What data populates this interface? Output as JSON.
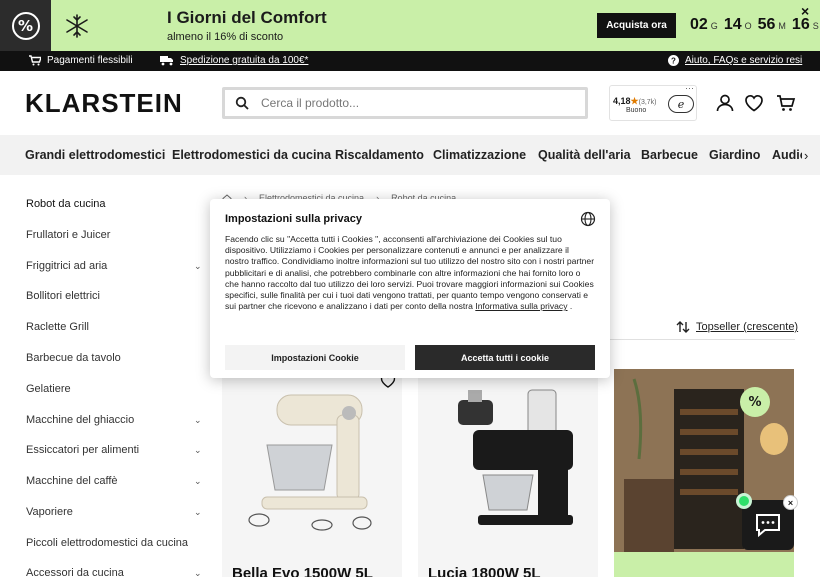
{
  "promo": {
    "title": "I Giorni del Comfort",
    "subtitle": "almeno il 16% di sconto",
    "button": "Acquista ora",
    "timer": [
      {
        "value": "02",
        "unit": "G"
      },
      {
        "value": "14",
        "unit": "O"
      },
      {
        "value": "56",
        "unit": "M"
      },
      {
        "value": "16",
        "unit": "S"
      }
    ],
    "percent_symbol": "%",
    "close": "×"
  },
  "infobar": {
    "flex": "Pagamenti flessibili",
    "shipping": "Spedizione gratuita da 100€*",
    "help": "Aiuto, FAQs e servizio resi"
  },
  "header": {
    "logo": "KLARSTEIN",
    "search_placeholder": "Cerca il prodotto...",
    "trust_rating": "4,18",
    "trust_count": "(3,7k)",
    "trust_label": "Buono",
    "trust_badge": "e",
    "trust_menu": "···"
  },
  "categories": [
    "Grandi elettrodomestici",
    "Elettrodomestici da cucina",
    "Riscaldamento",
    "Climatizzazione",
    "Qualità dell'aria",
    "Barbecue",
    "Giardino",
    "Audio"
  ],
  "sidebar": [
    {
      "label": "Robot da cucina",
      "chevron": false
    },
    {
      "label": "Frullatori e Juicer",
      "chevron": false
    },
    {
      "label": "Friggitrici ad aria",
      "chevron": true
    },
    {
      "label": "Bollitori elettrici",
      "chevron": false
    },
    {
      "label": "Raclette Grill",
      "chevron": false
    },
    {
      "label": "Barbecue da tavolo",
      "chevron": false
    },
    {
      "label": "Gelatiere",
      "chevron": false
    },
    {
      "label": "Macchine del ghiaccio",
      "chevron": true
    },
    {
      "label": "Essiccatori per alimenti",
      "chevron": true
    },
    {
      "label": "Macchine del caffè",
      "chevron": true
    },
    {
      "label": "Vaporiere",
      "chevron": true
    },
    {
      "label": "Piccoli elettrodomestici da cucina",
      "chevron": false
    },
    {
      "label": "Accessori da cucina",
      "chevron": true
    }
  ],
  "breadcrumb": [
    "Elettrodomestici da cucina",
    "Robot da cucina"
  ],
  "sort": {
    "label": "Topseller (crescente)"
  },
  "products": [
    {
      "title": "Bella Evo 1500W 5L"
    },
    {
      "title": "Lucia 1800W 5L"
    }
  ],
  "promo_tile": {
    "percent": "%"
  },
  "privacy": {
    "title": "Impostazioni sulla privacy",
    "body": "Facendo clic su \"Accetta tutti i Cookies \", acconsenti all'archiviazione dei Cookies sul tuo dispositivo. Utilizziamo i Cookies per personalizzare contenuti e annunci e per analizzare il nostro traffico. Condividiamo inoltre informazioni sul tuo utilizzo del nostro sito con i nostri partner pubblicitari e di analisi, che potrebbero combinarle con altre informazioni che hai fornito loro o che hanno raccolto dal tuo utilizzo dei loro servizi. Puoi trovare maggiori informazioni sui Cookies specifici, sulle finalità per cui i tuoi dati vengono trattati, per quanto tempo vengono conservati e sui partner che ricevono e analizzano i dati per conto della nostra",
    "link": "Informativa sulla privacy",
    "link_suffix": ".",
    "settings_button": "Impostazioni Cookie",
    "accept_button": "Accetta tutti i cookie"
  },
  "chat": {
    "close": "×"
  },
  "colors": {
    "accent_green": "#c9efa8",
    "dark": "#111111"
  }
}
